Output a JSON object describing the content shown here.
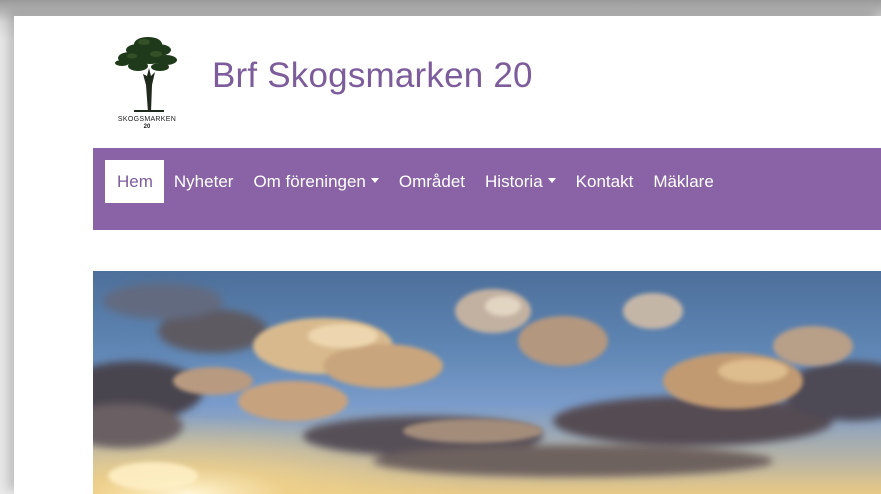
{
  "header": {
    "logo_text": "SKOGSMARKEN",
    "logo_number": "20",
    "logo_icon": "pine-tree-icon",
    "site_title": "Brf Skogsmarken 20"
  },
  "nav": {
    "items": [
      {
        "label": "Hem",
        "active": true,
        "dropdown": false
      },
      {
        "label": "Nyheter",
        "active": false,
        "dropdown": false
      },
      {
        "label": "Om föreningen",
        "active": false,
        "dropdown": true
      },
      {
        "label": "Området",
        "active": false,
        "dropdown": false
      },
      {
        "label": "Historia",
        "active": false,
        "dropdown": true
      },
      {
        "label": "Kontakt",
        "active": false,
        "dropdown": false
      },
      {
        "label": "Mäklare",
        "active": false,
        "dropdown": false
      }
    ]
  },
  "colors": {
    "brand_purple": "#8a63a6",
    "title_purple": "#7d5c9c",
    "nav_text": "#ffffff"
  },
  "hero": {
    "image": "sky-clouds-sunset-photo"
  }
}
